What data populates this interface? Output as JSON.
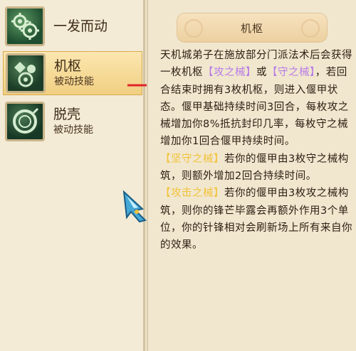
{
  "skills": [
    {
      "name": "一发而动",
      "type": "",
      "icon": "gears-icon",
      "selected": false
    },
    {
      "name": "机枢",
      "type": "被动技能",
      "icon": "mechanism-icon",
      "selected": true
    },
    {
      "name": "脱壳",
      "type": "被动技能",
      "icon": "shell-ring-icon",
      "selected": false
    }
  ],
  "detail": {
    "title": "机枢",
    "desc_p1": "天机城弟子在施放部分门派法术后会获得一枚机枢",
    "tag_attack": "【攻之械】",
    "word_or": "或",
    "tag_defense": "【守之械】",
    "desc_p2": "，若回合结束时拥有3枚机枢，则进入偃甲状态。偃甲基础持续时间3回合，每枚攻之械增加你8%抵抗封印几率，每枚守之械增加你1回合偃甲持续时间。",
    "tag_defense_set": "【坚守之械】",
    "desc_p3": "若你的偃甲由3枚守之械构筑，则额外增加2回合持续时间。",
    "tag_attack_set": "【攻击之械】",
    "desc_p4": "若你的偃甲由3枚攻之械构筑，则你的锋芒毕露会再额外作用3个单位，你的针锋相对会刷新场上所有来自你的效果。"
  },
  "colors": {
    "highlight_purple": "#b77be6",
    "highlight_yellow": "#f2c23a",
    "arrow_red": "#e0252a",
    "text_dark": "#2e2014"
  }
}
